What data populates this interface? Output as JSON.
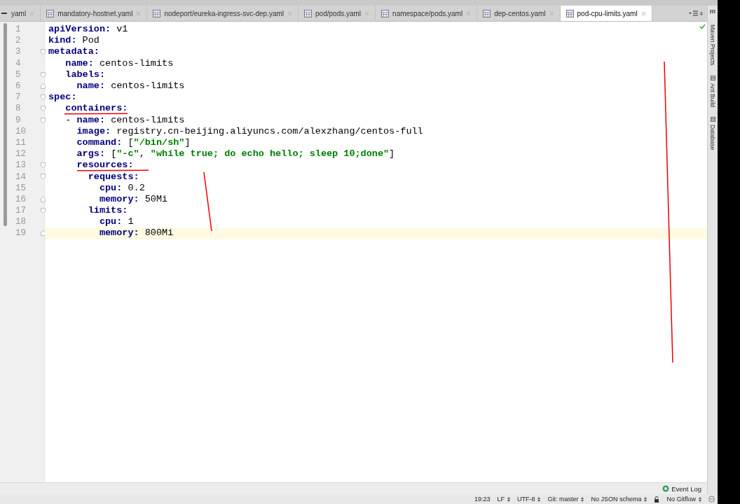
{
  "tabs": [
    {
      "label": "yaml",
      "selected": false
    },
    {
      "label": "mandatory-hostnet.yaml",
      "selected": false
    },
    {
      "label": "nodeport/eureka-ingress-svc-dep.yaml",
      "selected": false
    },
    {
      "label": "pod/pods.yaml",
      "selected": false
    },
    {
      "label": "namespace/pods.yaml",
      "selected": false
    },
    {
      "label": "dep-centos.yaml",
      "selected": false
    },
    {
      "label": "pod-cpu-limits.yaml",
      "selected": true
    }
  ],
  "tab_overflow": "4",
  "editor": {
    "lines": [
      {
        "number": "1",
        "current": false,
        "fold_open": false,
        "fold_close": false,
        "tokens": [
          {
            "kind": "key",
            "text": "apiVersion:"
          },
          {
            "kind": "plain",
            "text": " v1"
          }
        ]
      },
      {
        "number": "2",
        "current": false,
        "fold_open": false,
        "fold_close": false,
        "tokens": [
          {
            "kind": "key",
            "text": "kind:"
          },
          {
            "kind": "plain",
            "text": " Pod"
          }
        ]
      },
      {
        "number": "3",
        "current": false,
        "fold_open": true,
        "fold_close": false,
        "tokens": [
          {
            "kind": "key",
            "text": "metadata:"
          }
        ]
      },
      {
        "number": "4",
        "current": false,
        "fold_open": false,
        "fold_close": false,
        "tokens": [
          {
            "kind": "key",
            "text": "   name:"
          },
          {
            "kind": "plain",
            "text": " centos-limits"
          }
        ]
      },
      {
        "number": "5",
        "current": false,
        "fold_open": true,
        "fold_close": false,
        "tokens": [
          {
            "kind": "key",
            "text": "   labels:"
          }
        ]
      },
      {
        "number": "6",
        "current": false,
        "fold_open": false,
        "fold_close": true,
        "tokens": [
          {
            "kind": "key",
            "text": "     name:"
          },
          {
            "kind": "plain",
            "text": " centos-limits"
          }
        ]
      },
      {
        "number": "7",
        "current": false,
        "fold_open": true,
        "fold_close": false,
        "tokens": [
          {
            "kind": "key",
            "text": "spec:"
          }
        ]
      },
      {
        "number": "8",
        "current": false,
        "fold_open": true,
        "fold_close": false,
        "tokens": [
          {
            "kind": "key",
            "text": "   containers:"
          }
        ]
      },
      {
        "number": "9",
        "current": false,
        "fold_open": true,
        "fold_close": false,
        "tokens": [
          {
            "kind": "plain",
            "text": "   - "
          },
          {
            "kind": "key",
            "text": "name:"
          },
          {
            "kind": "plain",
            "text": " centos-limits"
          }
        ]
      },
      {
        "number": "10",
        "current": false,
        "fold_open": false,
        "fold_close": false,
        "tokens": [
          {
            "kind": "key",
            "text": "     image:"
          },
          {
            "kind": "plain",
            "text": " registry.cn-beijing.aliyuncs.com/alexzhang/centos-full"
          }
        ]
      },
      {
        "number": "11",
        "current": false,
        "fold_open": false,
        "fold_close": false,
        "tokens": [
          {
            "kind": "key",
            "text": "     command:"
          },
          {
            "kind": "plain",
            "text": " ["
          },
          {
            "kind": "string",
            "text": "\"/bin/sh\""
          },
          {
            "kind": "plain",
            "text": "]"
          }
        ]
      },
      {
        "number": "12",
        "current": false,
        "fold_open": false,
        "fold_close": false,
        "tokens": [
          {
            "kind": "key",
            "text": "     args:"
          },
          {
            "kind": "plain",
            "text": " ["
          },
          {
            "kind": "string",
            "text": "\"-c\""
          },
          {
            "kind": "plain",
            "text": ", "
          },
          {
            "kind": "string",
            "text": "\"while true; do echo hello; sleep 10;done\""
          },
          {
            "kind": "plain",
            "text": "]"
          }
        ]
      },
      {
        "number": "13",
        "current": false,
        "fold_open": true,
        "fold_close": false,
        "tokens": [
          {
            "kind": "key",
            "text": "     resources:"
          }
        ]
      },
      {
        "number": "14",
        "current": false,
        "fold_open": true,
        "fold_close": false,
        "tokens": [
          {
            "kind": "key",
            "text": "       requests:"
          }
        ]
      },
      {
        "number": "15",
        "current": false,
        "fold_open": false,
        "fold_close": false,
        "tokens": [
          {
            "kind": "key",
            "text": "         cpu:"
          },
          {
            "kind": "plain",
            "text": " 0.2"
          }
        ]
      },
      {
        "number": "16",
        "current": false,
        "fold_open": false,
        "fold_close": true,
        "tokens": [
          {
            "kind": "key",
            "text": "         memory:"
          },
          {
            "kind": "plain",
            "text": " 50Mi"
          }
        ]
      },
      {
        "number": "17",
        "current": false,
        "fold_open": true,
        "fold_close": false,
        "tokens": [
          {
            "kind": "key",
            "text": "       limits:"
          }
        ]
      },
      {
        "number": "18",
        "current": false,
        "fold_open": false,
        "fold_close": false,
        "tokens": [
          {
            "kind": "key",
            "text": "         cpu:"
          },
          {
            "kind": "plain",
            "text": " 1"
          }
        ]
      },
      {
        "number": "19",
        "current": true,
        "fold_open": false,
        "fold_close": true,
        "tokens": [
          {
            "kind": "key",
            "text": "         memory:"
          },
          {
            "kind": "plain",
            "text": " 800Mi"
          }
        ]
      }
    ]
  },
  "tool_windows": {
    "top": "m",
    "items": [
      "Maven Projects",
      "Ant Build",
      "Database"
    ]
  },
  "event_log": "Event Log",
  "status_bar": {
    "position": "19:23",
    "items": [
      "LF",
      "UTF-8",
      "Git: master",
      "No JSON schema"
    ],
    "gitflow": "No Gitflow"
  }
}
